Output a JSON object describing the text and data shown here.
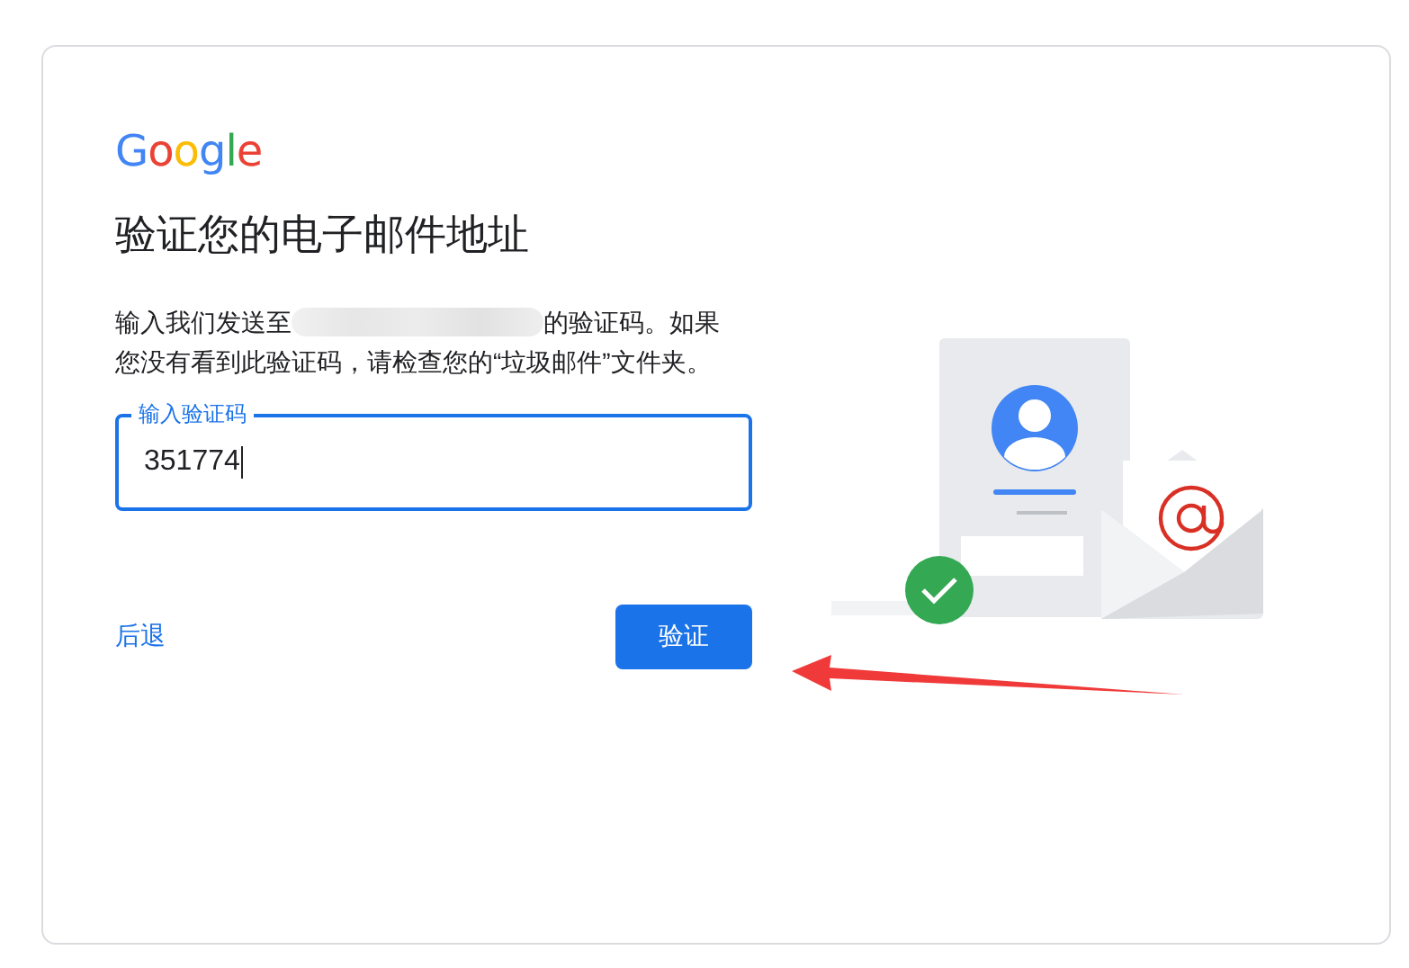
{
  "logo": "Google",
  "title": "验证您的电子邮件地址",
  "description": {
    "before": "输入我们发送至",
    "after": "的验证码。如果您没有看到此验证码，请检查您的“垃圾邮件”文件夹。"
  },
  "code_field": {
    "label": "输入验证码",
    "value": "351774",
    "focused": true
  },
  "back_link": "后退",
  "verify_button": "验证"
}
